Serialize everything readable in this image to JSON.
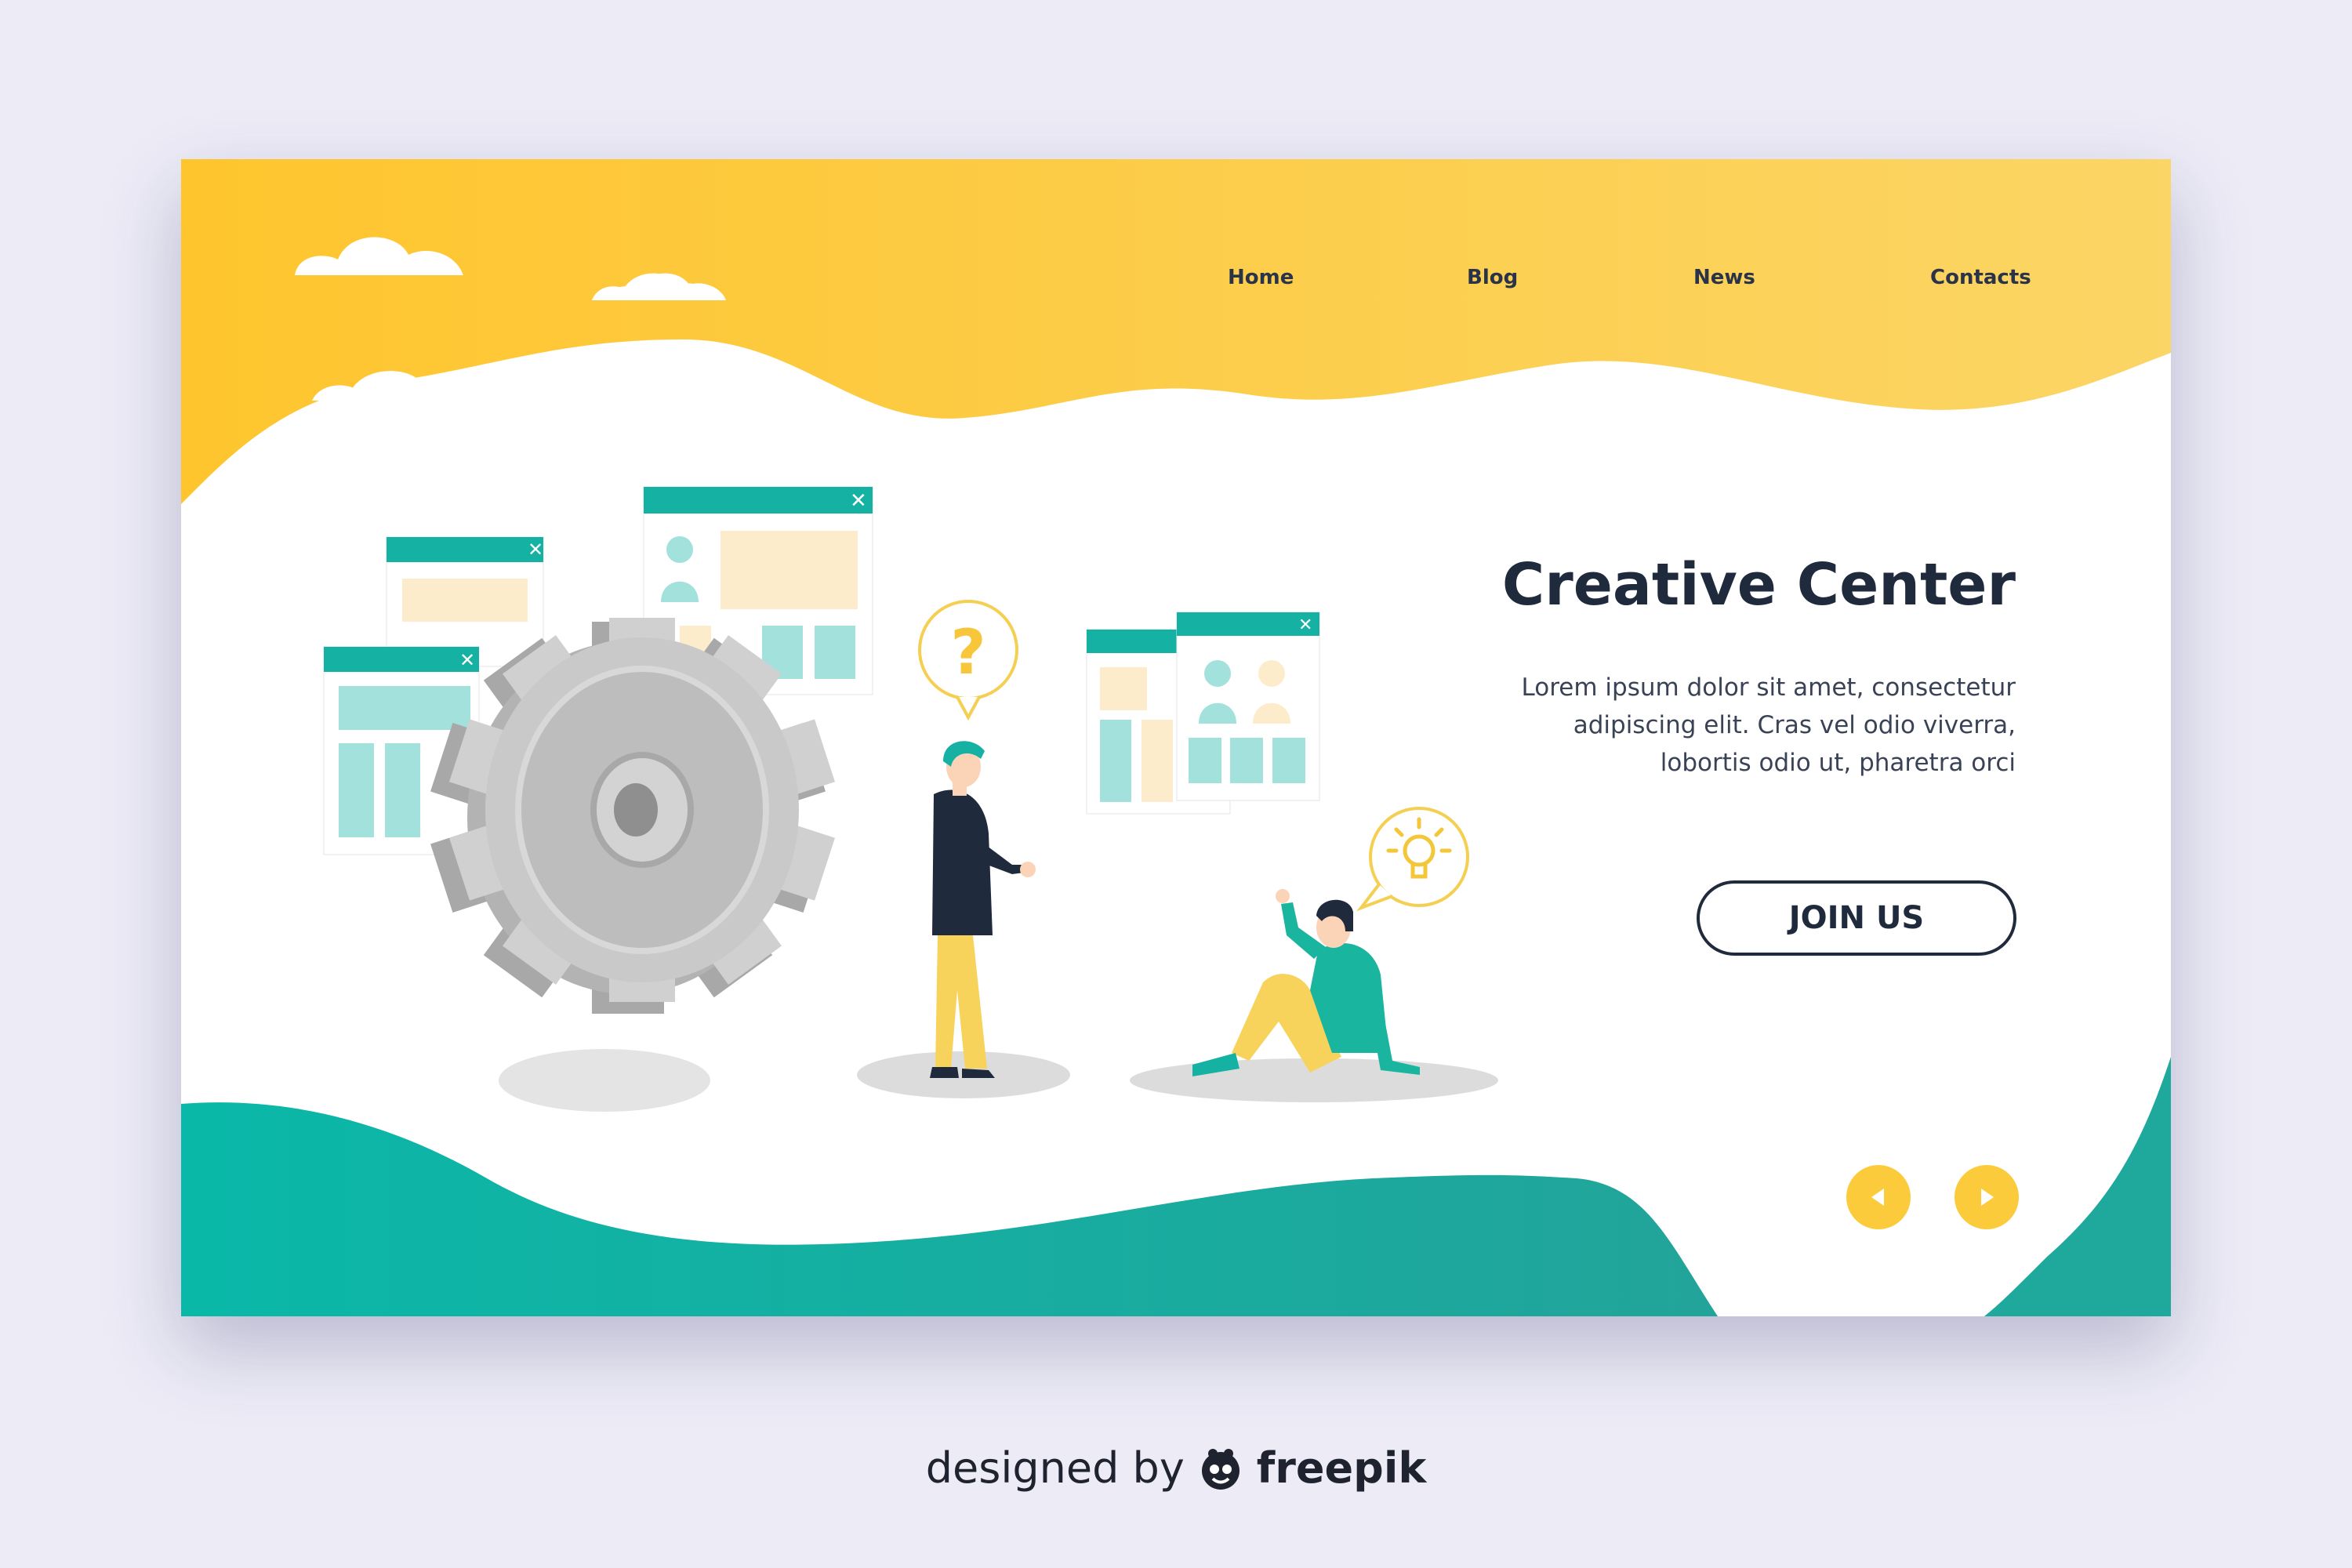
{
  "nav": {
    "items": [
      "Home",
      "Blog",
      "News",
      "Contacts"
    ]
  },
  "hero": {
    "title": "Creative Center",
    "description_lines": [
      "Lorem ipsum dolor sit amet, consectetur",
      "adipiscing elit. Cras vel odio viverra,",
      "lobortis odio ut, pharetra orci"
    ],
    "cta_label": "JOIN US"
  },
  "illustration": {
    "question_mark": "?"
  },
  "slider": {
    "prev_icon": "arrow-left-icon",
    "next_icon": "arrow-right-icon"
  },
  "credit": {
    "prefix": "designed by",
    "brand": "freepik"
  },
  "colors": {
    "yellow": "#fbcb3b",
    "teal": "#14b3a3",
    "navy": "#1f2a3d",
    "gear": "#c6c6c6",
    "background": "#ecebf6"
  }
}
